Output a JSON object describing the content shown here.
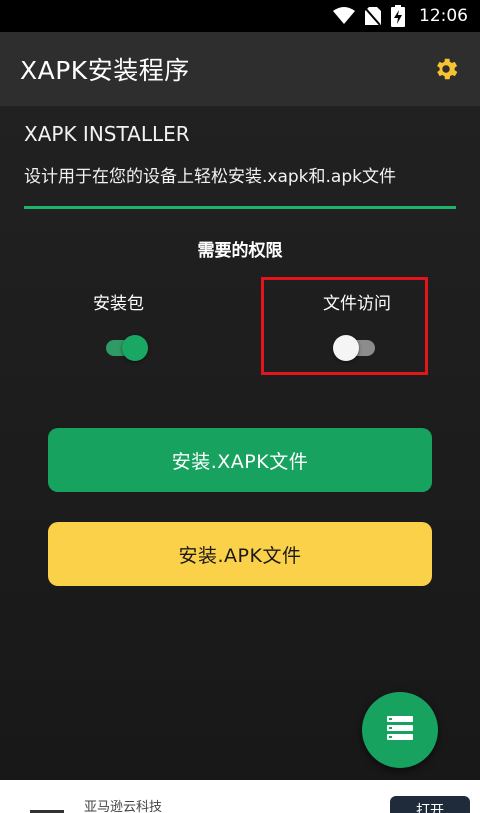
{
  "status_bar": {
    "time": "12:06",
    "icons": [
      "wifi-icon",
      "no-sim-icon",
      "battery-charging-icon"
    ]
  },
  "app_bar": {
    "title": "XAPK安装程序",
    "settings_icon": "gear-icon",
    "settings_color": "#f6c432"
  },
  "content": {
    "app_name": "XAPK INSTALLER",
    "description": "设计用于在您的设备上轻松安装.xapk和.apk文件",
    "permissions_title": "需要的权限",
    "permissions": [
      {
        "label": "安装包",
        "enabled": true
      },
      {
        "label": "文件访问",
        "enabled": false,
        "highlighted": true
      }
    ]
  },
  "buttons": {
    "install_xapk": "安装.XAPK文件",
    "install_apk": "安装.APK文件"
  },
  "fab": {
    "icon": "file-list-icon"
  },
  "ad_banner": {
    "company": "亚马逊云科技",
    "button_label": "打开"
  },
  "colors": {
    "accent_green": "#17a35f",
    "accent_yellow": "#fbd149",
    "highlight_red": "#e3141c",
    "app_bar_bg": "#2e2e2e"
  }
}
